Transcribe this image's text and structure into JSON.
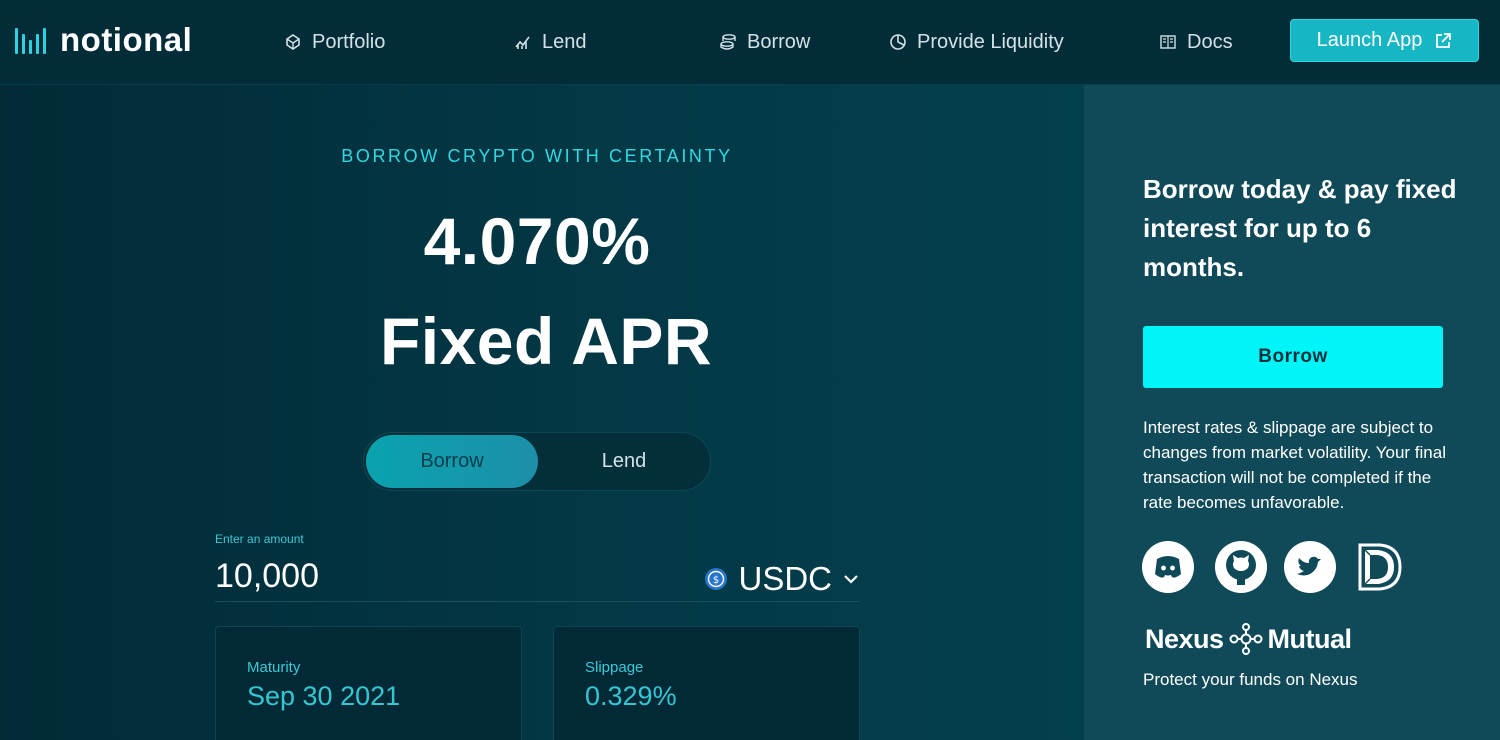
{
  "nav": {
    "brand": "notional",
    "items": [
      {
        "label": "Portfolio",
        "icon": "portfolio-icon"
      },
      {
        "label": "Lend",
        "icon": "lend-icon"
      },
      {
        "label": "Borrow",
        "icon": "coins-icon"
      },
      {
        "label": "Provide Liquidity",
        "icon": "pie-icon"
      },
      {
        "label": "Docs",
        "icon": "book-icon"
      }
    ],
    "launch_label": "Launch App"
  },
  "hero": {
    "kicker": "BORROW CRYPTO WITH CERTAINTY",
    "rate": "4.070%",
    "rate_suffix": "Fixed APR"
  },
  "toggle": {
    "active": "Borrow",
    "inactive": "Lend"
  },
  "amount": {
    "label": "Enter an amount",
    "value": "10,000",
    "currency": "USDC"
  },
  "cards": [
    {
      "label": "Maturity",
      "value": "Sep 30 2021"
    },
    {
      "label": "Slippage",
      "value": "0.329%"
    }
  ],
  "side": {
    "headline": "Borrow today & pay fixed interest for up to 6 months.",
    "button": "Borrow",
    "note": "Interest rates & slippage are subject to changes from market volatility. Your final transaction will not be completed if the rate becomes unfavorable.",
    "socials": [
      "discord-icon",
      "github-icon",
      "twitter-icon",
      "defipulse-icon"
    ],
    "nexus_left": "Nexus",
    "nexus_right": "Mutual",
    "nexus_text": "Protect your funds on Nexus"
  },
  "colors": {
    "accent": "#00f5f8",
    "teal": "#17b6c4",
    "panel": "#104a58",
    "background": "#03323f"
  }
}
